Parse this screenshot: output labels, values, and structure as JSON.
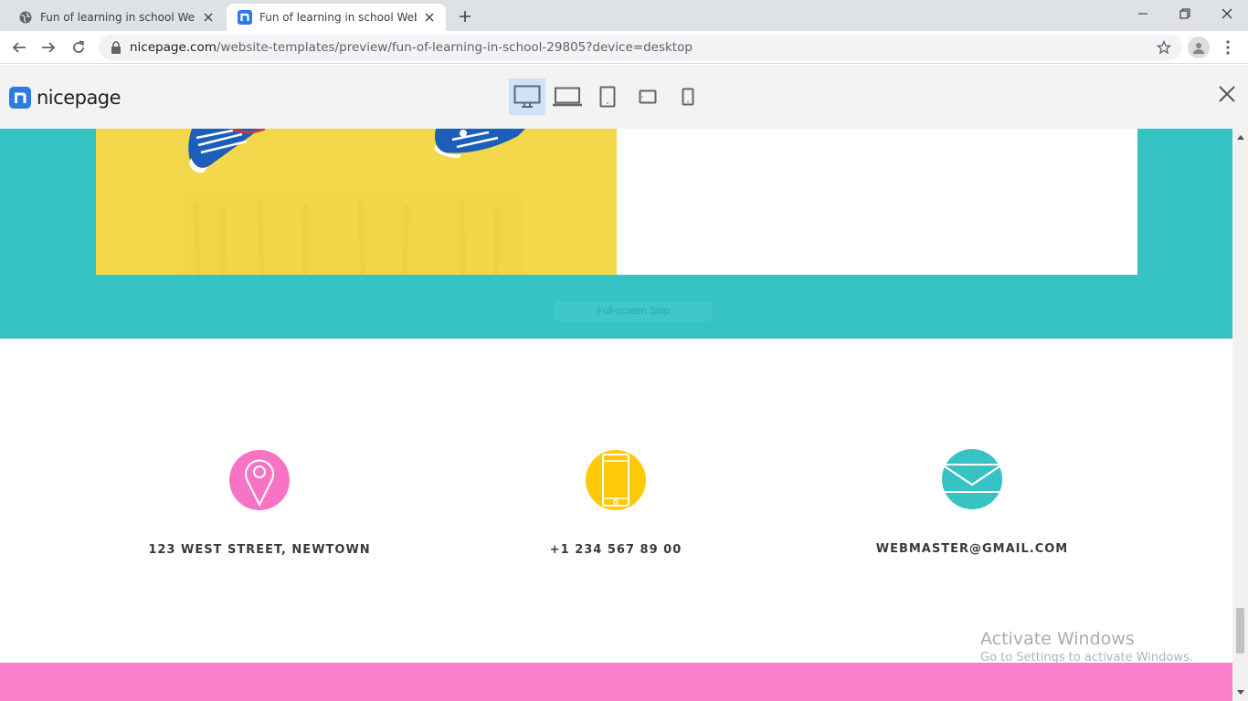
{
  "browser": {
    "tabs": [
      {
        "title": "Fun of learning in school Website",
        "active": false,
        "favicon": "globe-icon"
      },
      {
        "title": "Fun of learning in school Website",
        "active": true,
        "favicon": "nicepage-icon"
      }
    ],
    "url_host": "nicepage.com",
    "url_path": "/website-templates/preview/fun-of-learning-in-school-29805?device=desktop"
  },
  "preview_header": {
    "logo_text": "nicepage",
    "devices": [
      "desktop-icon",
      "laptop-icon",
      "tablet-icon",
      "tablet-landscape-icon",
      "phone-icon"
    ],
    "selected_device": "desktop-icon"
  },
  "page": {
    "colors": {
      "teal": "#37c3c3",
      "yellow": "#f3d84b",
      "pink": "#fb7fcb",
      "contact_pink": "#f774c4",
      "contact_yellow": "#ffc907",
      "contact_teal": "#37c3c3"
    },
    "snip_label": "Full-screen Snip",
    "contacts": [
      {
        "icon": "map-pin-icon",
        "text": "123 WEST STREET, NEWTOWN"
      },
      {
        "icon": "tablet-phone-icon",
        "text": "+1 234 567 89 00"
      },
      {
        "icon": "envelope-icon",
        "text": "WEBMASTER@GMAIL.COM"
      }
    ]
  },
  "windows_watermark": {
    "line1": "Activate Windows",
    "line2": "Go to Settings to activate Windows."
  }
}
